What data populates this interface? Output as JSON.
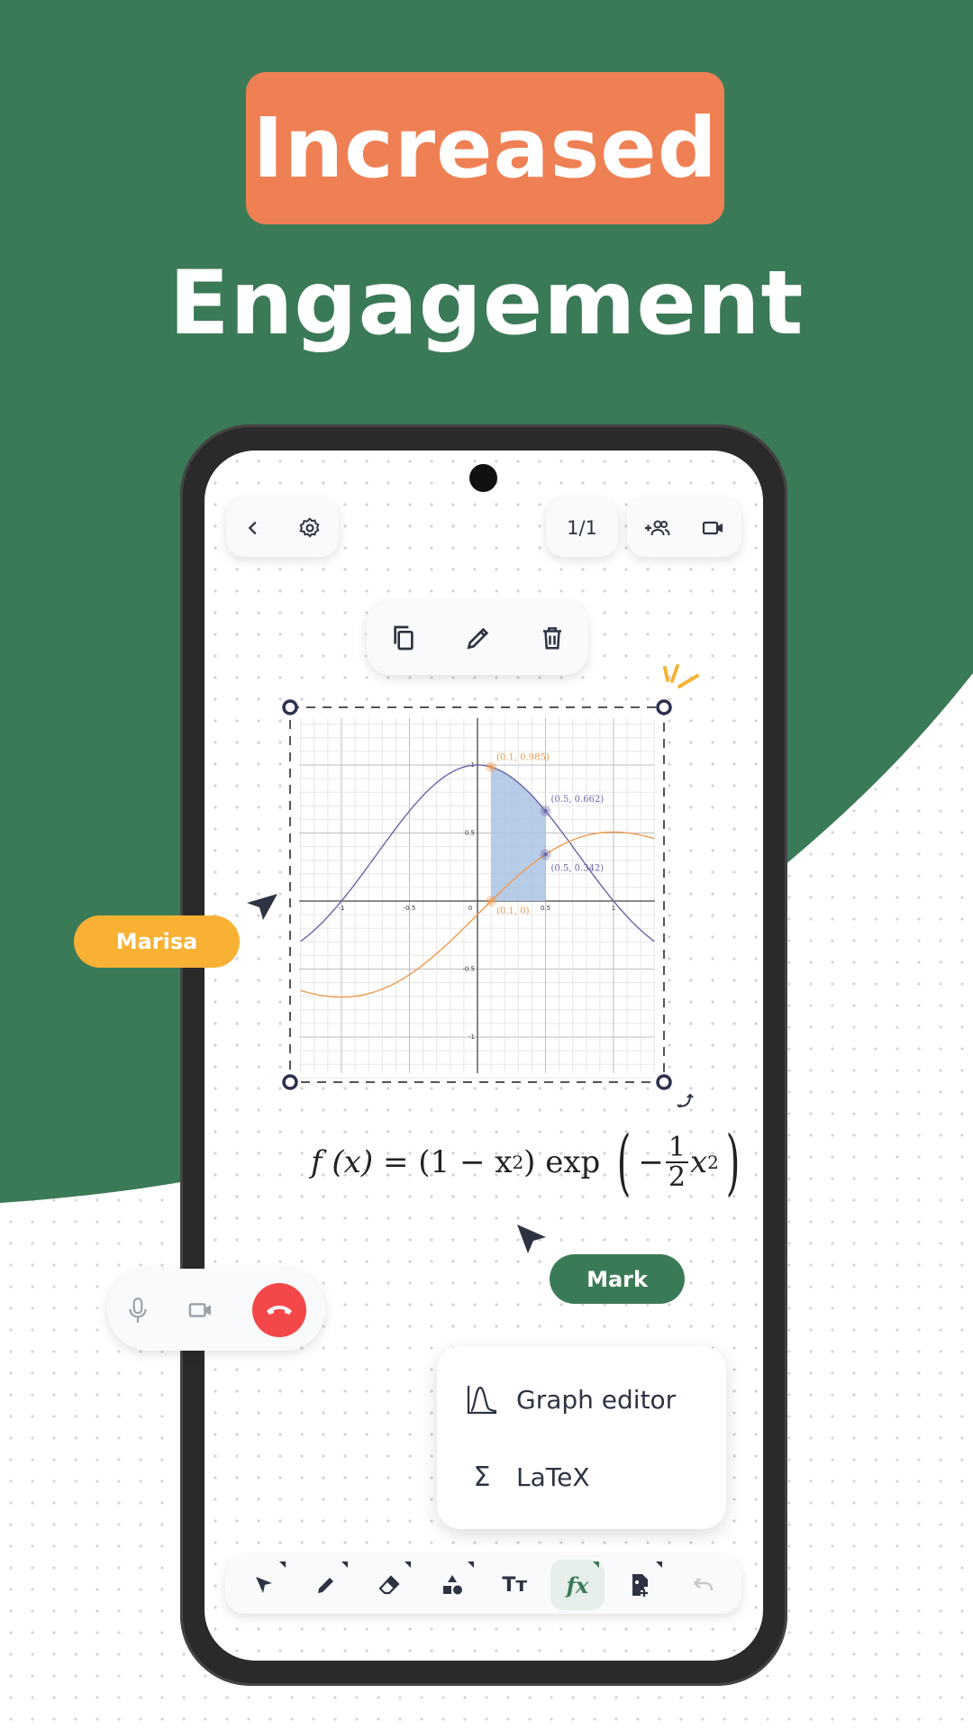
{
  "headline": {
    "badge": "Increased",
    "subtitle": "Engagement"
  },
  "colors": {
    "brand_green": "#3b7a57",
    "badge_orange": "#ef8054",
    "marisa": "#f8b133",
    "call_red": "#f4474a",
    "curve_blue": "#6b64a8",
    "curve_orange": "#ef9a4e",
    "shade": "#aac3e3"
  },
  "top_bar": {
    "back_icon": "chevron-left-icon",
    "settings_icon": "gear-icon",
    "page_indicator": "1/1",
    "add_user_icon": "add-people-icon",
    "video_icon": "video-camera-icon"
  },
  "context_toolbar": [
    "copy-icon",
    "pencil-icon",
    "trash-icon"
  ],
  "collaborators": [
    {
      "name": "Marisa"
    },
    {
      "name": "Mark"
    }
  ],
  "call_controls": [
    "microphone-icon",
    "video-camera-icon",
    "hang-up-icon"
  ],
  "formula": {
    "lhs": "f",
    "var": "(x)",
    "eq": "=",
    "part1": "(1 − x",
    "sup": "2",
    "close": ")",
    "exp": "exp",
    "minus": "−",
    "num": "1",
    "den": "2",
    "x2": "x"
  },
  "insert_menu": {
    "items": [
      {
        "label": "Graph editor",
        "icon": "graph-curve-icon"
      },
      {
        "label": "LaTeX",
        "icon": "sigma-icon"
      }
    ]
  },
  "bottom_toolbar": [
    "select-arrow-icon",
    "pen-icon",
    "eraser-icon",
    "shapes-icon",
    "text-icon",
    "function-icon",
    "insert-image-icon",
    "undo-icon"
  ],
  "chart_data": {
    "type": "line",
    "xlim": [
      -1.3,
      1.3
    ],
    "ylim": [
      -1.3,
      1.3
    ],
    "grid": true,
    "x_ticks": [
      "-1",
      "-0.5",
      "0",
      "0.5",
      "1"
    ],
    "y_ticks": [
      "1",
      "0.5",
      "-0.5",
      "-1"
    ],
    "series": [
      {
        "expression": "(1-x*x)*Math.exp(-x*x/2)",
        "color": "#6b64a8"
      },
      {
        "expression": "x*Math.exp(-x*x/2)-0.0995",
        "color": "#ef9a4e"
      }
    ],
    "shaded_region": {
      "x_from": 0.1,
      "x_to": 0.5,
      "under_series": 0
    },
    "points": [
      {
        "x": 0.1,
        "y": 0.985,
        "label": "(0.1, 0.985)",
        "color": "#ef9a4e"
      },
      {
        "x": 0.5,
        "y": 0.662,
        "label": "(0.5, 0.662)",
        "color": "#6b64a8"
      },
      {
        "x": 0.5,
        "y": 0.342,
        "label": "(0.5, 0.342)",
        "color": "#6b64a8"
      },
      {
        "x": 0.1,
        "y": 0,
        "label": "(0.1, 0)",
        "color": "#ef9a4e"
      }
    ]
  }
}
